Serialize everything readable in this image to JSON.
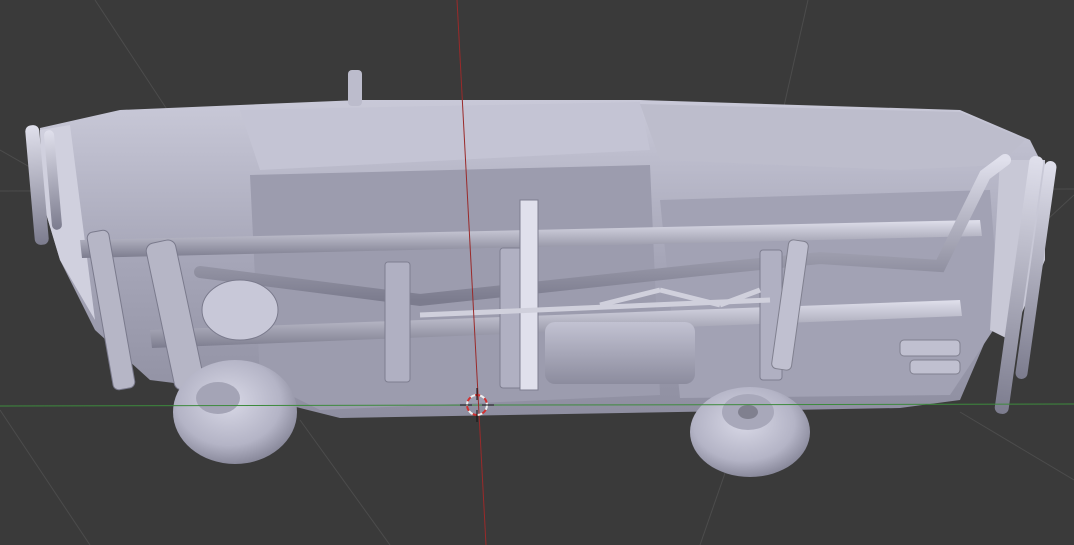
{
  "viewport": {
    "view": "bottom",
    "shading": "solid",
    "object": "car-undercarriage",
    "colors": {
      "background": "#3a3a3a",
      "grid_line": "#4a4a4a",
      "x_axis": "#3d8a3d",
      "y_axis": "#9a2a2a",
      "model_base": "#a9a9bb",
      "model_light": "#d4d4e2",
      "model_dark": "#6f6f80",
      "cursor_red": "#d23030",
      "cursor_white": "#f0f0f0"
    }
  }
}
